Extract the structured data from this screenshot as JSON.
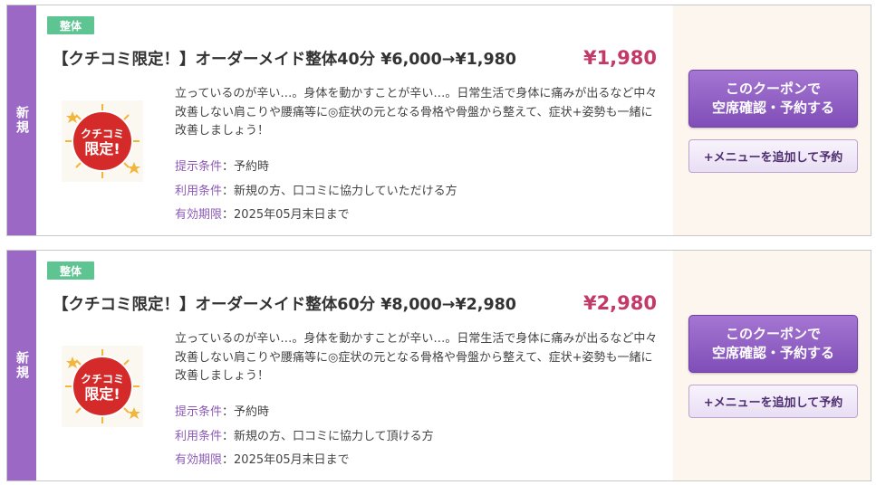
{
  "coupons": [
    {
      "badge": "新規",
      "category": "整体",
      "title": "【クチコミ限定！】オーダーメイド整体40分 ¥6,000→¥1,980",
      "price": "¥1,980",
      "badge_image_text": "クチコミ限定!",
      "description": "立っているのが辛い…。身体を動かすことが辛い…。日常生活で身体に痛みが出るなど中々改善しない肩こりや腰痛等に◎症状の元となる骨格や骨盤から整えて、症状+姿勢も一緒に改善しましょう！",
      "conditions": [
        {
          "label": "提示条件",
          "value": "予約時"
        },
        {
          "label": "利用条件",
          "value": "新規の方、口コミに協力していただける方"
        },
        {
          "label": "有効期限",
          "value": "2025年05月末日まで"
        }
      ],
      "button_main_line1": "このクーポンで",
      "button_main_line2": "空席確認・予約する",
      "button_add": "+メニューを追加して予約"
    },
    {
      "badge": "新規",
      "category": "整体",
      "title": "【クチコミ限定！】オーダーメイド整体60分 ¥8,000→¥2,980",
      "price": "¥2,980",
      "badge_image_text": "クチコミ限定!",
      "description": "立っているのが辛い…。身体を動かすことが辛い…。日常生活で身体に痛みが出るなど中々改善しない肩こりや腰痛等に◎症状の元となる骨格や骨盤から整えて、症状+姿勢も一緒に改善しましょう！",
      "conditions": [
        {
          "label": "提示条件",
          "value": "予約時"
        },
        {
          "label": "利用条件",
          "value": "新規の方、口コミに協力して頂ける方"
        },
        {
          "label": "有効期限",
          "value": "2025年05月末日まで"
        }
      ],
      "button_main_line1": "このクーポンで",
      "button_main_line2": "空席確認・予約する",
      "button_add": "+メニューを追加して予約"
    }
  ],
  "colors": {
    "new_strip": "#9b68c6",
    "category_tag": "#5ec592",
    "price": "#c33a6a",
    "condition_label": "#8e5cb7",
    "primary_button": "#8a5ac0",
    "side_panel": "#fdf6ee"
  }
}
